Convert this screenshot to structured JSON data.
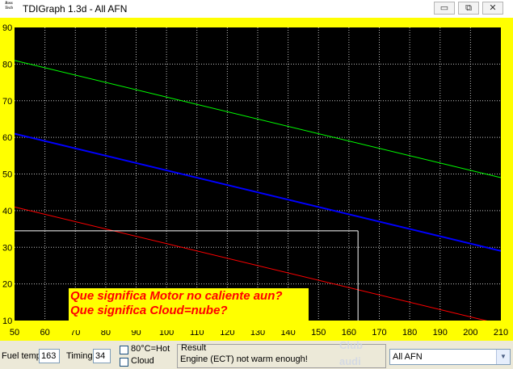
{
  "window": {
    "title": "TDIGraph 1.3d - All AFN",
    "logo_text": "Ross Tech",
    "minimize_glyph": "▭",
    "restore_glyph": "⧉",
    "close_glyph": "✕"
  },
  "colors": {
    "plot_background": "#000000",
    "frame": "#ffff00",
    "grid": "#ffffff",
    "series_green": "#00ff00",
    "series_blue": "#0000ff",
    "series_red": "#ff0000",
    "marker": "#ffffff"
  },
  "chart_data": {
    "type": "line",
    "title": "",
    "xlabel": "",
    "ylabel": "",
    "xlim": [
      50,
      210
    ],
    "ylim": [
      10,
      90
    ],
    "x_ticks": [
      50,
      60,
      70,
      80,
      90,
      100,
      110,
      120,
      130,
      140,
      150,
      160,
      170,
      180,
      190,
      200,
      210
    ],
    "y_ticks": [
      10,
      20,
      30,
      40,
      50,
      60,
      70,
      80,
      90
    ],
    "grid": true,
    "series": [
      {
        "color": "green",
        "x": [
          50,
          210
        ],
        "y": [
          81,
          49
        ]
      },
      {
        "color": "blue",
        "x": [
          50,
          210
        ],
        "y": [
          61,
          29
        ]
      },
      {
        "color": "red",
        "x": [
          50,
          210
        ],
        "y": [
          41,
          9
        ]
      }
    ],
    "marker": {
      "x": 163,
      "y": 34.5
    }
  },
  "annotation": {
    "line1": "Que significa Motor no caliente aun?",
    "line2": "Que significa Cloud=nube?"
  },
  "status": {
    "fuel_temp_label": "Fuel temp",
    "fuel_temp_value": "163",
    "timing_label": "Timing",
    "timing_value": "34",
    "hot_label": "80°C=Hot",
    "cloud_label": "Cloud",
    "result_label": "Result",
    "result_text": "Engine (ECT) not warm enough!",
    "select_value": "All AFN"
  },
  "watermark": {
    "line1": "Club",
    "line2": "audi"
  }
}
